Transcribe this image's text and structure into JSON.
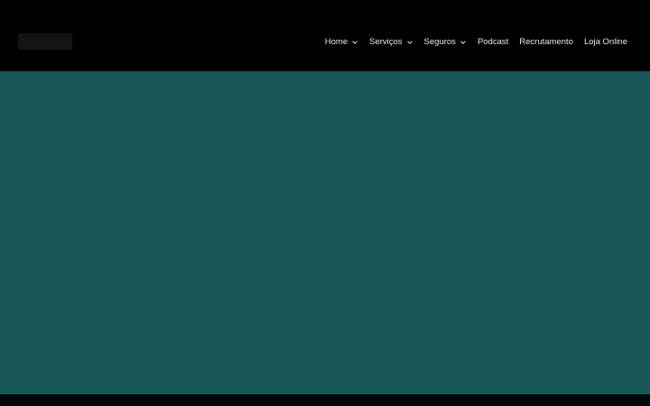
{
  "colors": {
    "header_bg": "#000000",
    "hero_bg": "#175757",
    "nav_text": "#e8e8e8",
    "logo_placeholder": "#141414"
  },
  "nav": {
    "items": [
      {
        "label": "Home",
        "dropdown": true,
        "icon": "chevron-down-icon"
      },
      {
        "label": "Serviços",
        "dropdown": true,
        "icon": "chevron-down-icon"
      },
      {
        "label": "Seguros",
        "dropdown": true,
        "icon": "chevron-down-icon"
      },
      {
        "label": "Podcast",
        "dropdown": false
      },
      {
        "label": "Recrutamento",
        "dropdown": false
      },
      {
        "label": "Loja Online",
        "dropdown": false
      }
    ]
  }
}
